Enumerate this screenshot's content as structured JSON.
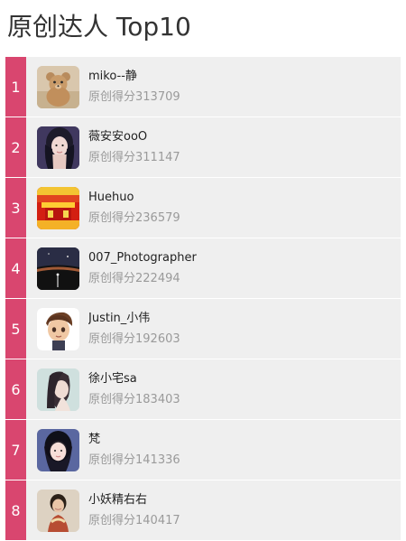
{
  "header": {
    "title": "原创达人 Top10"
  },
  "ranking": {
    "items": [
      {
        "rank": "1",
        "name": "miko--静",
        "score_label": "原创得分",
        "score": "313709",
        "avatar": "teddy-bear"
      },
      {
        "rank": "2",
        "name": "薇安安ooO",
        "score_label": "原创得分",
        "score": "311147",
        "avatar": "woman-dark-hair"
      },
      {
        "rank": "3",
        "name": "Huehuo",
        "score_label": "原创得分",
        "score": "236579",
        "avatar": "red-yellow-stage"
      },
      {
        "rank": "4",
        "name": "007_Photographer",
        "score_label": "原创得分",
        "score": "222494",
        "avatar": "night-sky"
      },
      {
        "rank": "5",
        "name": "Justin_小伟",
        "score_label": "原创得分",
        "score": "192603",
        "avatar": "cartoon-boy"
      },
      {
        "rank": "6",
        "name": "徐小宅sa",
        "score_label": "原创得分",
        "score": "183403",
        "avatar": "woman-side-profile"
      },
      {
        "rank": "7",
        "name": "梵",
        "score_label": "原创得分",
        "score": "141336",
        "avatar": "girl-portrait"
      },
      {
        "rank": "8",
        "name": "小妖精右右",
        "score_label": "原创得分",
        "score": "140417",
        "avatar": "woman-smiling"
      }
    ]
  },
  "colors": {
    "accent": "#d9466f",
    "row_bg": "#efefef",
    "score_text": "#9a9a9a"
  }
}
